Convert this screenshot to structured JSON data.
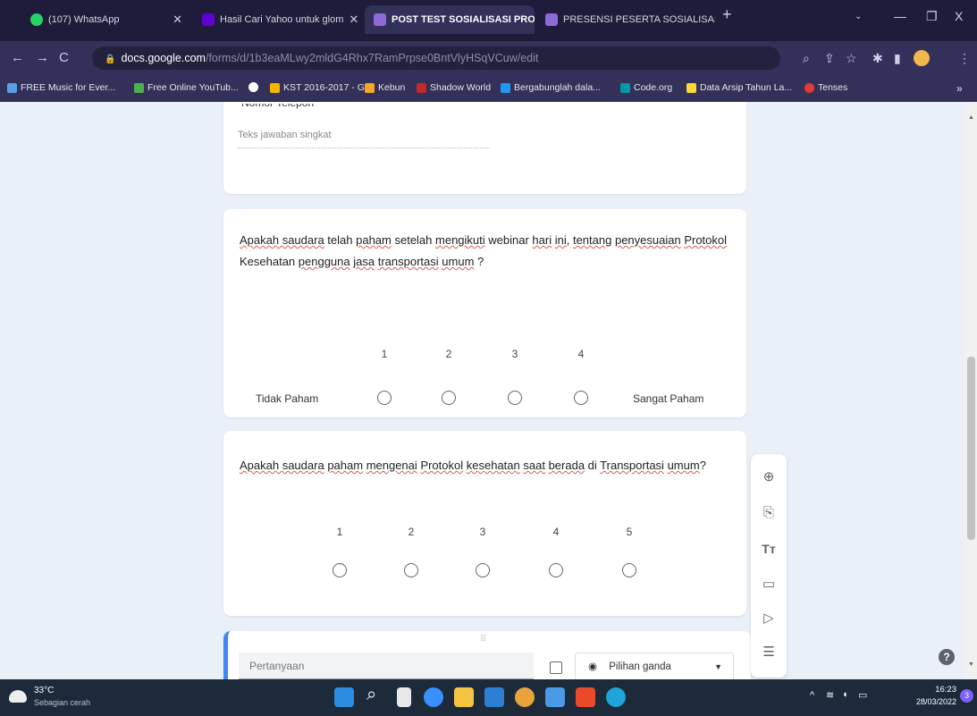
{
  "tabs": [
    {
      "label": "(107) WhatsApp",
      "color": "#25d366"
    },
    {
      "label": "Hasil Cari Yahoo untuk glom",
      "color": "#6001d2"
    },
    {
      "label": "POST TEST SOSIALISASI PROTO",
      "color": "#673ab7"
    },
    {
      "label": "PRESENSI PESERTA SOSIALISASI",
      "color": "#673ab7"
    }
  ],
  "new_tab": "+",
  "window_controls": {
    "minimize": "—",
    "maximize": "❐",
    "close": "X"
  },
  "address": {
    "domain": "docs.google.com",
    "path": "/forms/d/1b3eaMLwy2mldG4Rhx7RamPrpse0BntVlyHSqVCuw/edit"
  },
  "bookmarks": [
    {
      "label": "FREE Music for Ever...",
      "color": "#5c9ce6"
    },
    {
      "label": "Free Online YouTub...",
      "color": "#4caf50"
    },
    {
      "label": "",
      "color": "#ffffff"
    },
    {
      "label": "KST 2016-2017 - G...",
      "color": "#f4b400"
    },
    {
      "label": "Kebun",
      "color": "#f9a825"
    },
    {
      "label": "Shadow World",
      "color": "#c62828"
    },
    {
      "label": "Bergabunglah dala...",
      "color": "#2196f3"
    },
    {
      "label": "Code.org",
      "color": "#0097a7"
    },
    {
      "label": "Data Arsip Tahun La...",
      "color": "#fdd835"
    },
    {
      "label": "Tenses",
      "color": "#e53935"
    }
  ],
  "top_card": {
    "partial_label": "Nomor Telepon",
    "placeholder": "Teks jawaban singkat"
  },
  "question1": {
    "text_parts": [
      "Apakah saudara",
      " telah ",
      "paham",
      " setelah ",
      "mengikuti",
      " webinar ",
      "hari",
      " ",
      "ini,",
      " ",
      "tentang",
      " ",
      "penyesuaian",
      " ",
      "Protokol"
    ],
    "line2_parts": [
      "Kesehatan ",
      "pengguna",
      " ",
      "jasa",
      " ",
      "transportasi",
      " ",
      "umum",
      " ?"
    ],
    "scale": [
      "1",
      "2",
      "3",
      "4"
    ],
    "low_label": "Tidak Paham",
    "high_label": "Sangat Paham"
  },
  "question2": {
    "text_parts": [
      "Apakah saudara",
      " ",
      "paham",
      " ",
      "mengenai",
      " ",
      "Protokol",
      " ",
      "kesehatan",
      " ",
      "saat",
      " ",
      "berada",
      " di ",
      "Transportasi",
      " ",
      "umum",
      "?"
    ],
    "scale": [
      "1",
      "2",
      "3",
      "4",
      "5"
    ]
  },
  "new_question": {
    "placeholder": "Pertanyaan",
    "type": "Pilihan ganda"
  },
  "side_toolbar": [
    "add-question-icon",
    "import-questions-icon",
    "add-title-icon",
    "add-image-icon",
    "add-video-icon",
    "add-section-icon"
  ],
  "help": "?",
  "taskbar": {
    "temp": "33°C",
    "weather": "Sebagian cerah",
    "time": "16:23",
    "date": "28/03/2022",
    "notif": "3"
  }
}
